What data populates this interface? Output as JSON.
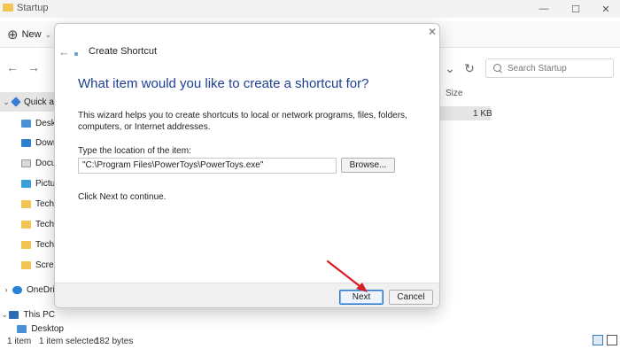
{
  "explorer": {
    "window_title": "Startup",
    "new_label": "New",
    "search_placeholder": "Search Startup",
    "sidebar": [
      {
        "label": "Quick a",
        "icon": "star-icon",
        "caret": "⌄"
      },
      {
        "label": "Deskt",
        "icon": "desktop-icon"
      },
      {
        "label": "Down",
        "icon": "download-icon"
      },
      {
        "label": "Docu",
        "icon": "document-icon"
      },
      {
        "label": "Pictur",
        "icon": "picture-icon"
      },
      {
        "label": "Techv",
        "icon": "folder-icon"
      },
      {
        "label": "Techv",
        "icon": "folder-icon"
      },
      {
        "label": "Techv",
        "icon": "folder-icon"
      },
      {
        "label": "Scree",
        "icon": "folder-icon"
      },
      {
        "label": "OneDri",
        "icon": "cloud-icon",
        "caret": "›"
      },
      {
        "label": "This PC",
        "icon": "pc-icon",
        "caret": "⌄"
      },
      {
        "label": "Desktop",
        "icon": "desktop-icon"
      }
    ],
    "column_size_header": "Size",
    "row_size_value": "1 KB",
    "status": {
      "item_count": "1 item",
      "selected": "1 item selected",
      "size": "182 bytes"
    }
  },
  "dialog": {
    "title": "Create Shortcut",
    "heading": "What item would you like to create a shortcut for?",
    "description": "This wizard helps you to create shortcuts to local or network programs, files, folders, computers, or Internet addresses.",
    "location_label": "Type the location of the item:",
    "location_value": "\"C:\\Program Files\\PowerToys\\PowerToys.exe\"",
    "browse_label": "Browse...",
    "hint": "Click Next to continue.",
    "next_label": "Next",
    "cancel_label": "Cancel"
  },
  "colors": {
    "heading": "#1c3f94",
    "annotation_arrow": "#d81f26",
    "default_button_border": "#2b73c9"
  }
}
